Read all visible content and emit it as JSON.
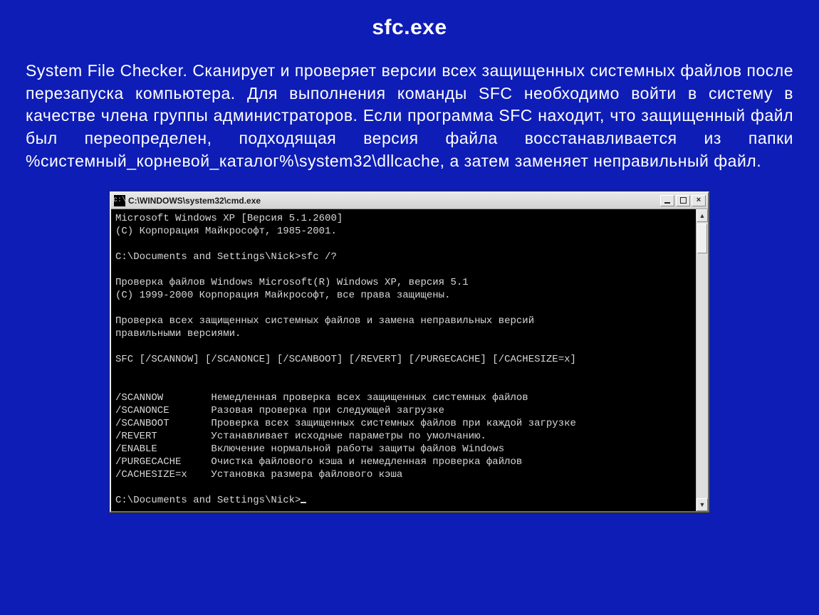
{
  "title": "sfc.exe",
  "body": "System File Checker. Сканирует и проверяет версии всех защищенных системных файлов после перезапуска компьютера. Для выполнения команды SFC необходимо войти в систему в качестве члена группы администраторов. Если программа SFC находит, что защищенный файл был переопределен, подходящая версия файла восстанавливается из папки %системный_корневой_каталог%\\system32\\dllcache, а затем заменяет неправильный файл.",
  "console": {
    "title": "C:\\WINDOWS\\system32\\cmd.exe",
    "icon_glyph": "c:\\",
    "lines": {
      "l01": "Microsoft Windows XP [Версия 5.1.2600]",
      "l02": "(С) Корпорация Майкрософт, 1985-2001.",
      "l03": "",
      "l04": "C:\\Documents and Settings\\Nick>sfc /?",
      "l05": "",
      "l06": "Проверка файлов Windows Microsoft(R) Windows XP, версия 5.1",
      "l07": "(С) 1999-2000 Корпорация Майкрософт, все права защищены.",
      "l08": "",
      "l09": "Проверка всех защищенных системных файлов и замена неправильных версий",
      "l10": "правильными версиями.",
      "l11": "",
      "l12": "SFC [/SCANNOW] [/SCANONCE] [/SCANBOOT] [/REVERT] [/PURGECACHE] [/CACHESIZE=x]",
      "l13": "",
      "l14": "",
      "l15": "/SCANNOW        Немедленная проверка всех защищенных системных файлов",
      "l16": "/SCANONCE       Разовая проверка при следующей загрузке",
      "l17": "/SCANBOOT       Проверка всех защищенных системных файлов при каждой загрузке",
      "l18": "/REVERT         Устанавливает исходные параметры по умолчанию.",
      "l19": "/ENABLE         Включение нормальной работы защиты файлов Windows",
      "l20": "/PURGECACHE     Очистка файлового кэша и немедленная проверка файлов",
      "l21": "/CACHESIZE=x    Установка размера файлового кэша",
      "l22": "",
      "l23": "C:\\Documents and Settings\\Nick>"
    }
  }
}
